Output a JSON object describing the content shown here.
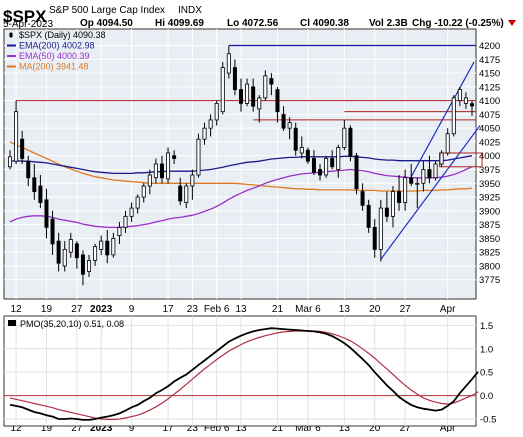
{
  "header": {
    "ticker": "$SPX",
    "name": "S&P 500 Large Cap Index",
    "exchange": "INDX",
    "date": "5-Apr-2023",
    "open": "Op 4094.50",
    "high": "Hi 4099.69",
    "low": "Lo 4072.56",
    "close": "Cl 4090.38",
    "volume": "Vol 2.3B",
    "change": "Chg -10.22 (-0.25%)"
  },
  "legend": [
    {
      "label": "$SPX (Daily) 4090.38",
      "color": "#000000",
      "marker": "candle"
    },
    {
      "label": "EMA(200) 4002.98",
      "color": "#1a1a8c",
      "marker": "line"
    },
    {
      "label": "EMA(50) 4000.39",
      "color": "#9b30c8",
      "marker": "line"
    },
    {
      "label": "MA(200) 3941.48",
      "color": "#e07a1f",
      "marker": "line"
    }
  ],
  "colors": {
    "price_bg": "#e8eef4",
    "grid": "#ffffff",
    "candle": "#000000",
    "resistance": "#b22222",
    "top_line": "#1a1aa0",
    "channel": "#2030c0",
    "ema200": "#1a1a8c",
    "ema50": "#9b30c8",
    "ma200": "#e07a1f",
    "pmo": "#000000",
    "pmo_signal": "#b03040",
    "zero_line": "#b03040",
    "change_arrow": "#cc0000"
  },
  "x_labels": [
    "12",
    "19",
    "27",
    "2023",
    "9",
    "17",
    "23",
    "Feb 6",
    "13",
    "21",
    "Mar 6",
    "13",
    "20",
    "27",
    "Apr"
  ],
  "pmo_label": "PMO(35,20,10) 0.51, 0.08",
  "chart_data": [
    {
      "type": "candlestick",
      "title": "$SPX (Daily)",
      "ylim": [
        3740,
        4230
      ],
      "yticks": [
        3775,
        3800,
        3825,
        3850,
        3875,
        3900,
        3925,
        3950,
        3975,
        4000,
        4025,
        4050,
        4075,
        4100,
        4125,
        4150,
        4175,
        4200
      ],
      "candles": [
        {
          "o": 3980,
          "h": 4010,
          "l": 3975,
          "c": 3998
        },
        {
          "o": 3990,
          "h": 4100,
          "l": 3985,
          "c": 4080
        },
        {
          "o": 4030,
          "h": 4045,
          "l": 3985,
          "c": 3995
        },
        {
          "o": 3990,
          "h": 4000,
          "l": 3945,
          "c": 3960
        },
        {
          "o": 3960,
          "h": 3985,
          "l": 3920,
          "c": 3935
        },
        {
          "o": 3945,
          "h": 3965,
          "l": 3905,
          "c": 3915
        },
        {
          "o": 3920,
          "h": 3940,
          "l": 3850,
          "c": 3870
        },
        {
          "o": 3885,
          "h": 3900,
          "l": 3820,
          "c": 3840
        },
        {
          "o": 3845,
          "h": 3860,
          "l": 3790,
          "c": 3805
        },
        {
          "o": 3800,
          "h": 3845,
          "l": 3790,
          "c": 3830
        },
        {
          "o": 3825,
          "h": 3860,
          "l": 3815,
          "c": 3848
        },
        {
          "o": 3840,
          "h": 3845,
          "l": 3795,
          "c": 3815
        },
        {
          "o": 3820,
          "h": 3828,
          "l": 3765,
          "c": 3785
        },
        {
          "o": 3790,
          "h": 3820,
          "l": 3780,
          "c": 3810
        },
        {
          "o": 3810,
          "h": 3840,
          "l": 3800,
          "c": 3835
        },
        {
          "o": 3830,
          "h": 3855,
          "l": 3820,
          "c": 3845
        },
        {
          "o": 3845,
          "h": 3865,
          "l": 3805,
          "c": 3820
        },
        {
          "o": 3820,
          "h": 3860,
          "l": 3815,
          "c": 3850
        },
        {
          "o": 3855,
          "h": 3880,
          "l": 3840,
          "c": 3870
        },
        {
          "o": 3870,
          "h": 3900,
          "l": 3860,
          "c": 3890
        },
        {
          "o": 3890,
          "h": 3915,
          "l": 3880,
          "c": 3905
        },
        {
          "o": 3905,
          "h": 3930,
          "l": 3895,
          "c": 3925
        },
        {
          "o": 3925,
          "h": 3950,
          "l": 3915,
          "c": 3945
        },
        {
          "o": 3945,
          "h": 3975,
          "l": 3930,
          "c": 3965
        },
        {
          "o": 3960,
          "h": 3995,
          "l": 3950,
          "c": 3985
        },
        {
          "o": 3985,
          "h": 4000,
          "l": 3950,
          "c": 3960
        },
        {
          "o": 3958,
          "h": 4015,
          "l": 3950,
          "c": 4005
        },
        {
          "o": 4000,
          "h": 4010,
          "l": 3985,
          "c": 3995
        },
        {
          "o": 3945,
          "h": 3960,
          "l": 3910,
          "c": 3918
        },
        {
          "o": 3915,
          "h": 3950,
          "l": 3905,
          "c": 3945
        },
        {
          "o": 3945,
          "h": 3975,
          "l": 3920,
          "c": 3965
        },
        {
          "o": 3965,
          "h": 4040,
          "l": 3960,
          "c": 4030
        },
        {
          "o": 4030,
          "h": 4060,
          "l": 4020,
          "c": 4050
        },
        {
          "o": 4050,
          "h": 4075,
          "l": 4035,
          "c": 4065
        },
        {
          "o": 4065,
          "h": 4100,
          "l": 4055,
          "c": 4095
        },
        {
          "o": 4080,
          "h": 4170,
          "l": 4075,
          "c": 4160
        },
        {
          "o": 4150,
          "h": 4200,
          "l": 4140,
          "c": 4185
        },
        {
          "o": 4160,
          "h": 4175,
          "l": 4110,
          "c": 4120
        },
        {
          "o": 4120,
          "h": 4140,
          "l": 4080,
          "c": 4095
        },
        {
          "o": 4095,
          "h": 4140,
          "l": 4090,
          "c": 4130
        },
        {
          "o": 4125,
          "h": 4140,
          "l": 4080,
          "c": 4090
        },
        {
          "o": 4085,
          "h": 4110,
          "l": 4060,
          "c": 4105
        },
        {
          "o": 4105,
          "h": 4155,
          "l": 4100,
          "c": 4145
        },
        {
          "o": 4140,
          "h": 4150,
          "l": 4110,
          "c": 4130
        },
        {
          "o": 4120,
          "h": 4125,
          "l": 4060,
          "c": 4080
        },
        {
          "o": 4075,
          "h": 4090,
          "l": 4045,
          "c": 4050
        },
        {
          "o": 4050,
          "h": 4070,
          "l": 4030,
          "c": 4060
        },
        {
          "o": 4050,
          "h": 4060,
          "l": 4000,
          "c": 4010
        },
        {
          "o": 4005,
          "h": 4035,
          "l": 3995,
          "c": 4015
        },
        {
          "o": 4010,
          "h": 4015,
          "l": 3985,
          "c": 3990
        },
        {
          "o": 3995,
          "h": 4010,
          "l": 3965,
          "c": 3970
        },
        {
          "o": 3975,
          "h": 3985,
          "l": 3955,
          "c": 3965
        },
        {
          "o": 3965,
          "h": 4000,
          "l": 3960,
          "c": 3995
        },
        {
          "o": 3995,
          "h": 4010,
          "l": 3975,
          "c": 3980
        },
        {
          "o": 3975,
          "h": 4020,
          "l": 3960,
          "c": 4015
        },
        {
          "o": 4015,
          "h": 4065,
          "l": 4010,
          "c": 4050
        },
        {
          "o": 4050,
          "h": 4055,
          "l": 3990,
          "c": 4000
        },
        {
          "o": 4000,
          "h": 4005,
          "l": 3930,
          "c": 3940
        },
        {
          "o": 3935,
          "h": 3950,
          "l": 3900,
          "c": 3910
        },
        {
          "o": 3910,
          "h": 3920,
          "l": 3860,
          "c": 3870
        },
        {
          "o": 3870,
          "h": 3885,
          "l": 3815,
          "c": 3830
        },
        {
          "o": 3830,
          "h": 3920,
          "l": 3808,
          "c": 3905
        },
        {
          "o": 3905,
          "h": 3935,
          "l": 3880,
          "c": 3890
        },
        {
          "o": 3890,
          "h": 3945,
          "l": 3870,
          "c": 3935
        },
        {
          "o": 3935,
          "h": 3965,
          "l": 3900,
          "c": 3915
        },
        {
          "o": 3915,
          "h": 3975,
          "l": 3900,
          "c": 3960
        },
        {
          "o": 3960,
          "h": 3985,
          "l": 3945,
          "c": 3950
        },
        {
          "o": 3950,
          "h": 3960,
          "l": 3905,
          "c": 3950
        },
        {
          "o": 3950,
          "h": 3990,
          "l": 3935,
          "c": 3975
        },
        {
          "o": 3975,
          "h": 4000,
          "l": 3950,
          "c": 3960
        },
        {
          "o": 3960,
          "h": 3990,
          "l": 3955,
          "c": 3985
        },
        {
          "o": 3985,
          "h": 4010,
          "l": 3980,
          "c": 4005
        },
        {
          "o": 4005,
          "h": 4050,
          "l": 4000,
          "c": 4040
        },
        {
          "o": 4040,
          "h": 4110,
          "l": 4035,
          "c": 4105
        },
        {
          "o": 4100,
          "h": 4125,
          "l": 4090,
          "c": 4120
        },
        {
          "o": 4095,
          "h": 4115,
          "l": 4085,
          "c": 4105
        },
        {
          "o": 4094.5,
          "h": 4099.69,
          "l": 4072.56,
          "c": 4090.38
        }
      ],
      "lines": {
        "ema200": [
          3990,
          3991,
          3990,
          3990,
          3989,
          3988,
          3987,
          3985,
          3983,
          3981,
          3979,
          3977,
          3975,
          3973,
          3971,
          3970,
          3969,
          3968,
          3968,
          3968,
          3968,
          3969,
          3969,
          3970,
          3971,
          3971,
          3972,
          3972,
          3972,
          3972,
          3972,
          3973,
          3974,
          3975,
          3977,
          3979,
          3982,
          3984,
          3986,
          3988,
          3989,
          3990,
          3992,
          3994,
          3995,
          3996,
          3997,
          3997,
          3998,
          3998,
          3998,
          3998,
          3998,
          3998,
          3998,
          3999,
          3999,
          3998,
          3997,
          3996,
          3994,
          3993,
          3992,
          3992,
          3991,
          3991,
          3991,
          3991,
          3991,
          3991,
          3991,
          3991,
          3992,
          3994,
          3996,
          3998,
          4000
        ],
        "ema50": [
          3880,
          3885,
          3888,
          3890,
          3891,
          3891,
          3890,
          3888,
          3885,
          3883,
          3881,
          3879,
          3876,
          3874,
          3872,
          3871,
          3870,
          3870,
          3870,
          3871,
          3872,
          3873,
          3875,
          3877,
          3880,
          3882,
          3885,
          3887,
          3888,
          3890,
          3892,
          3895,
          3899,
          3903,
          3908,
          3914,
          3921,
          3927,
          3932,
          3937,
          3941,
          3945,
          3950,
          3954,
          3957,
          3960,
          3963,
          3965,
          3967,
          3968,
          3969,
          3970,
          3971,
          3972,
          3973,
          3974,
          3975,
          3974,
          3973,
          3971,
          3968,
          3966,
          3964,
          3963,
          3962,
          3961,
          3960,
          3960,
          3960,
          3960,
          3960,
          3961,
          3963,
          3966,
          3970,
          3975,
          3980
        ],
        "ma200": [
          4025,
          4020,
          4015,
          4010,
          4005,
          4000,
          3995,
          3990,
          3985,
          3980,
          3976,
          3972,
          3968,
          3965,
          3962,
          3960,
          3958,
          3956,
          3955,
          3954,
          3953,
          3952,
          3951,
          3950,
          3950,
          3950,
          3950,
          3950,
          3950,
          3950,
          3950,
          3950,
          3950,
          3950,
          3950,
          3950,
          3950,
          3950,
          3949,
          3948,
          3947,
          3946,
          3945,
          3944,
          3943,
          3942,
          3941,
          3940,
          3940,
          3939,
          3939,
          3938,
          3938,
          3938,
          3938,
          3938,
          3938,
          3937,
          3937,
          3937,
          3937,
          3936,
          3936,
          3936,
          3936,
          3936,
          3936,
          3936,
          3937,
          3937,
          3937,
          3938,
          3938,
          3939,
          3940,
          3940,
          3941
        ]
      },
      "annotations": {
        "top_line": 4200,
        "resistance_lines": [
          4100,
          4065,
          4080
        ],
        "channel": {
          "lower": [
            [
              3812,
              3830
            ],
            [
              4035,
              4055
            ]
          ],
          "upper": [
            [
              3962,
              3980
            ],
            [
              4150,
              4170
            ]
          ]
        },
        "highlight_box": [
          3980,
          4005
        ]
      }
    },
    {
      "type": "line",
      "title": "PMO(35,20,10)",
      "ylim": [
        -0.65,
        1.7
      ],
      "yticks": [
        -0.5,
        0.0,
        0.5,
        1.0,
        1.5
      ],
      "zero_line": 0.0,
      "series": [
        {
          "name": "PMO",
          "values": [
            -0.2,
            -0.22,
            -0.25,
            -0.3,
            -0.35,
            -0.38,
            -0.42,
            -0.45,
            -0.5,
            -0.5,
            -0.49,
            -0.5,
            -0.52,
            -0.52,
            -0.5,
            -0.47,
            -0.45,
            -0.42,
            -0.38,
            -0.32,
            -0.25,
            -0.2,
            -0.12,
            -0.05,
            0.05,
            0.12,
            0.2,
            0.3,
            0.38,
            0.45,
            0.55,
            0.65,
            0.75,
            0.85,
            0.95,
            1.05,
            1.15,
            1.22,
            1.28,
            1.33,
            1.37,
            1.4,
            1.42,
            1.44,
            1.43,
            1.42,
            1.41,
            1.4,
            1.39,
            1.38,
            1.37,
            1.35,
            1.32,
            1.27,
            1.2,
            1.12,
            1.02,
            0.9,
            0.78,
            0.65,
            0.5,
            0.36,
            0.22,
            0.1,
            -0.03,
            -0.12,
            -0.2,
            -0.25,
            -0.28,
            -0.3,
            -0.32,
            -0.3,
            -0.22,
            -0.12,
            0.05,
            0.2,
            0.35,
            0.51
          ]
        },
        {
          "name": "Signal",
          "values": [
            -0.05,
            -0.08,
            -0.11,
            -0.14,
            -0.17,
            -0.2,
            -0.23,
            -0.26,
            -0.3,
            -0.33,
            -0.36,
            -0.39,
            -0.42,
            -0.45,
            -0.48,
            -0.5,
            -0.51,
            -0.51,
            -0.5,
            -0.48,
            -0.45,
            -0.42,
            -0.37,
            -0.31,
            -0.24,
            -0.16,
            -0.07,
            0.03,
            0.13,
            0.24,
            0.35,
            0.46,
            0.57,
            0.67,
            0.77,
            0.86,
            0.95,
            1.02,
            1.09,
            1.15,
            1.2,
            1.24,
            1.28,
            1.31,
            1.34,
            1.36,
            1.37,
            1.38,
            1.38,
            1.38,
            1.38,
            1.37,
            1.35,
            1.32,
            1.28,
            1.23,
            1.17,
            1.09,
            1.0,
            0.9,
            0.8,
            0.68,
            0.57,
            0.45,
            0.33,
            0.22,
            0.12,
            0.03,
            -0.05,
            -0.1,
            -0.14,
            -0.17,
            -0.18,
            -0.16,
            -0.11,
            -0.05,
            0.0,
            0.08
          ]
        }
      ]
    }
  ]
}
